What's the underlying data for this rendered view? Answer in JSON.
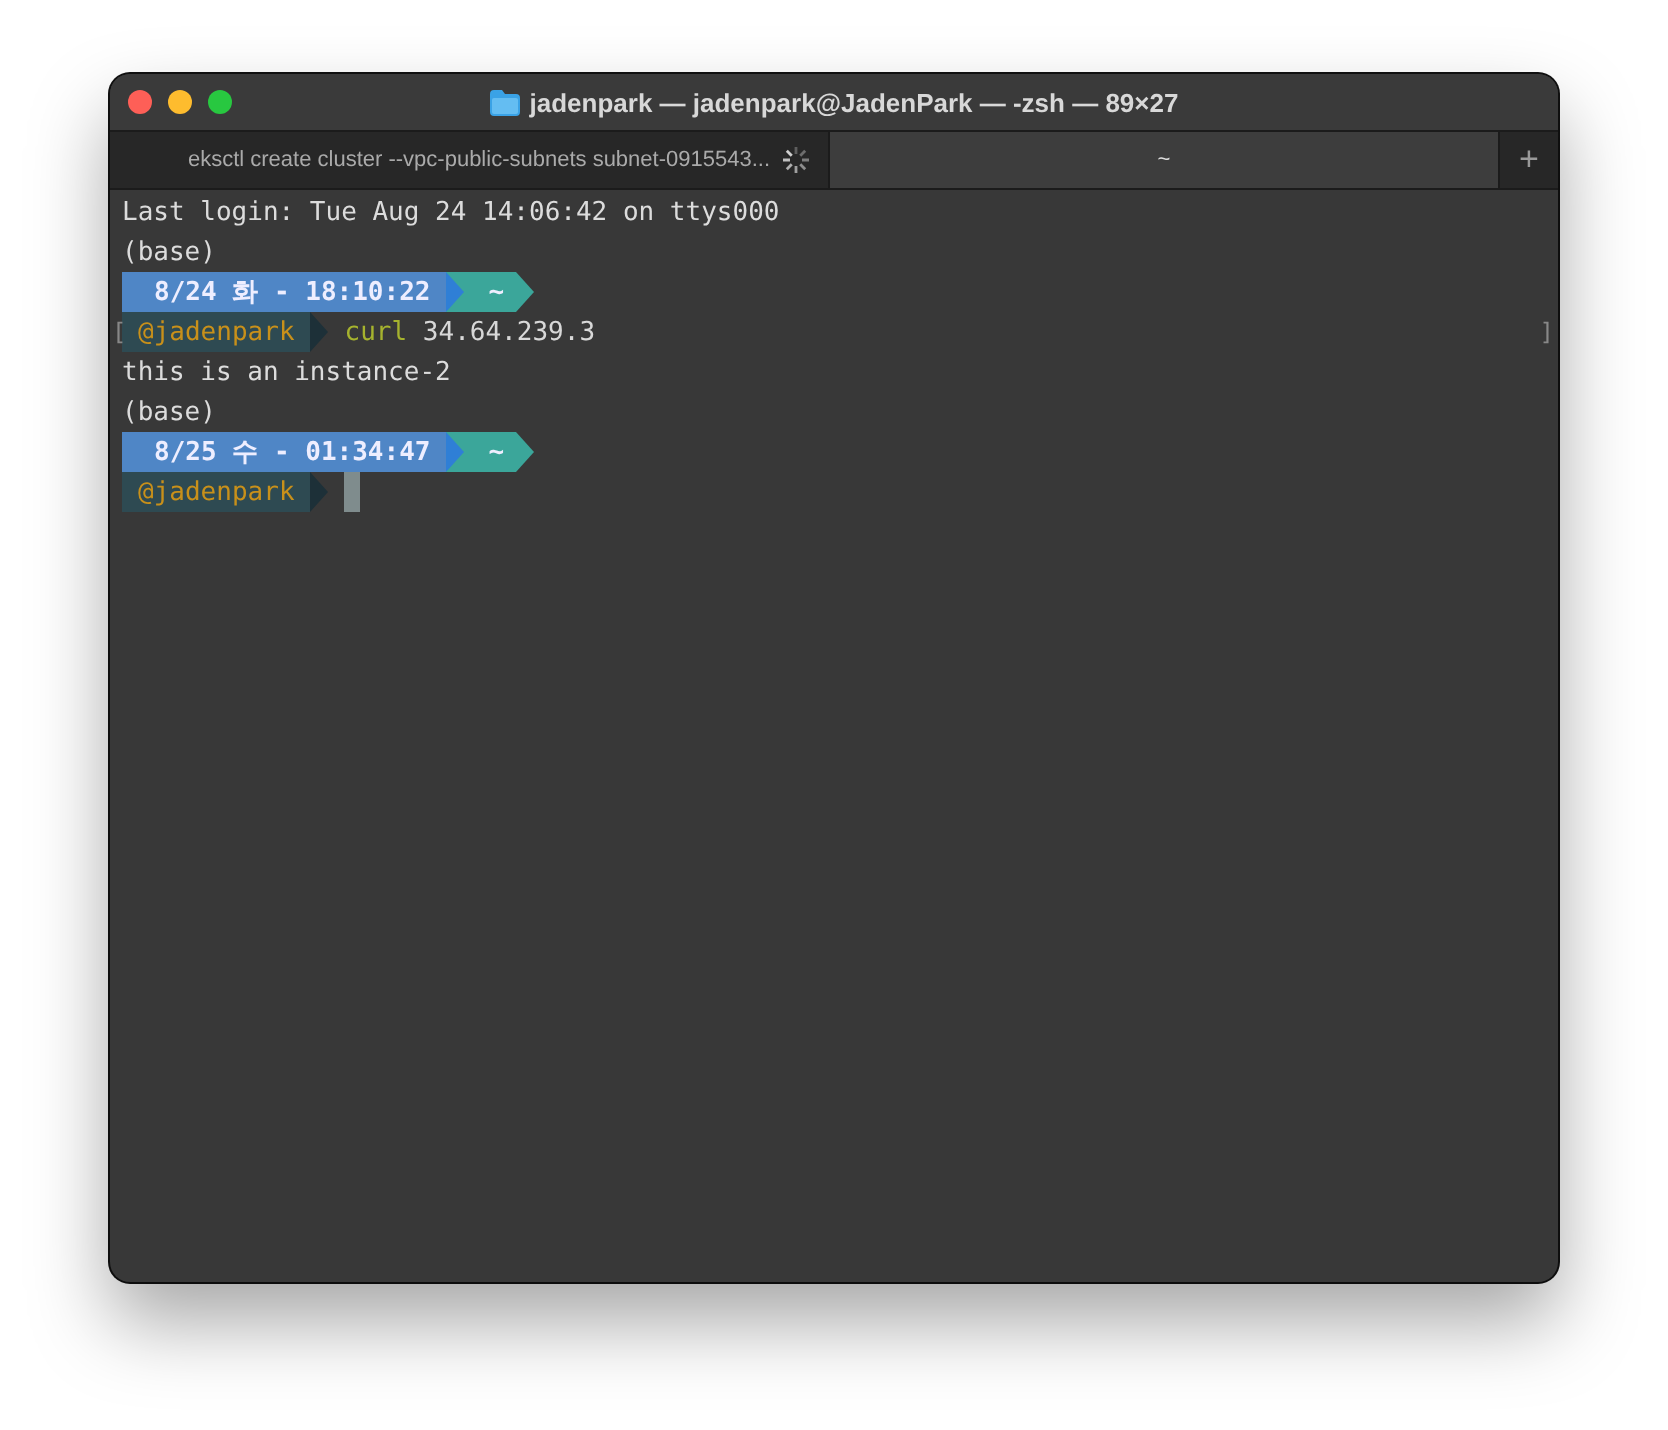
{
  "window": {
    "title": "jadenpark — jadenpark@JadenPark — -zsh — 89×27"
  },
  "tabs": [
    {
      "label": "eksctl create cluster --vpc-public-subnets subnet-0915543...",
      "selected": false,
      "busy": true
    },
    {
      "label": "~",
      "selected": true,
      "busy": false
    }
  ],
  "new_tab": "+",
  "lines": [
    {
      "kind": "text",
      "text": "Last login: Tue Aug 24 14:06:42 on ttys000"
    },
    {
      "kind": "text",
      "text": "(base)"
    },
    {
      "kind": "date",
      "date": "8/24 화 - 18:10:22",
      "dir": "~"
    },
    {
      "kind": "user",
      "user": "@jadenpark",
      "command": "curl",
      "args": "34.64.239.3",
      "left_mark": "[",
      "right_mark": "]",
      "cursor": false
    },
    {
      "kind": "text",
      "text": "this is an instance-2"
    },
    {
      "kind": "text",
      "text": "(base)"
    },
    {
      "kind": "date",
      "date": "8/25 수 - 01:34:47",
      "dir": "~"
    },
    {
      "kind": "user",
      "user": "@jadenpark",
      "cursor": true
    }
  ]
}
